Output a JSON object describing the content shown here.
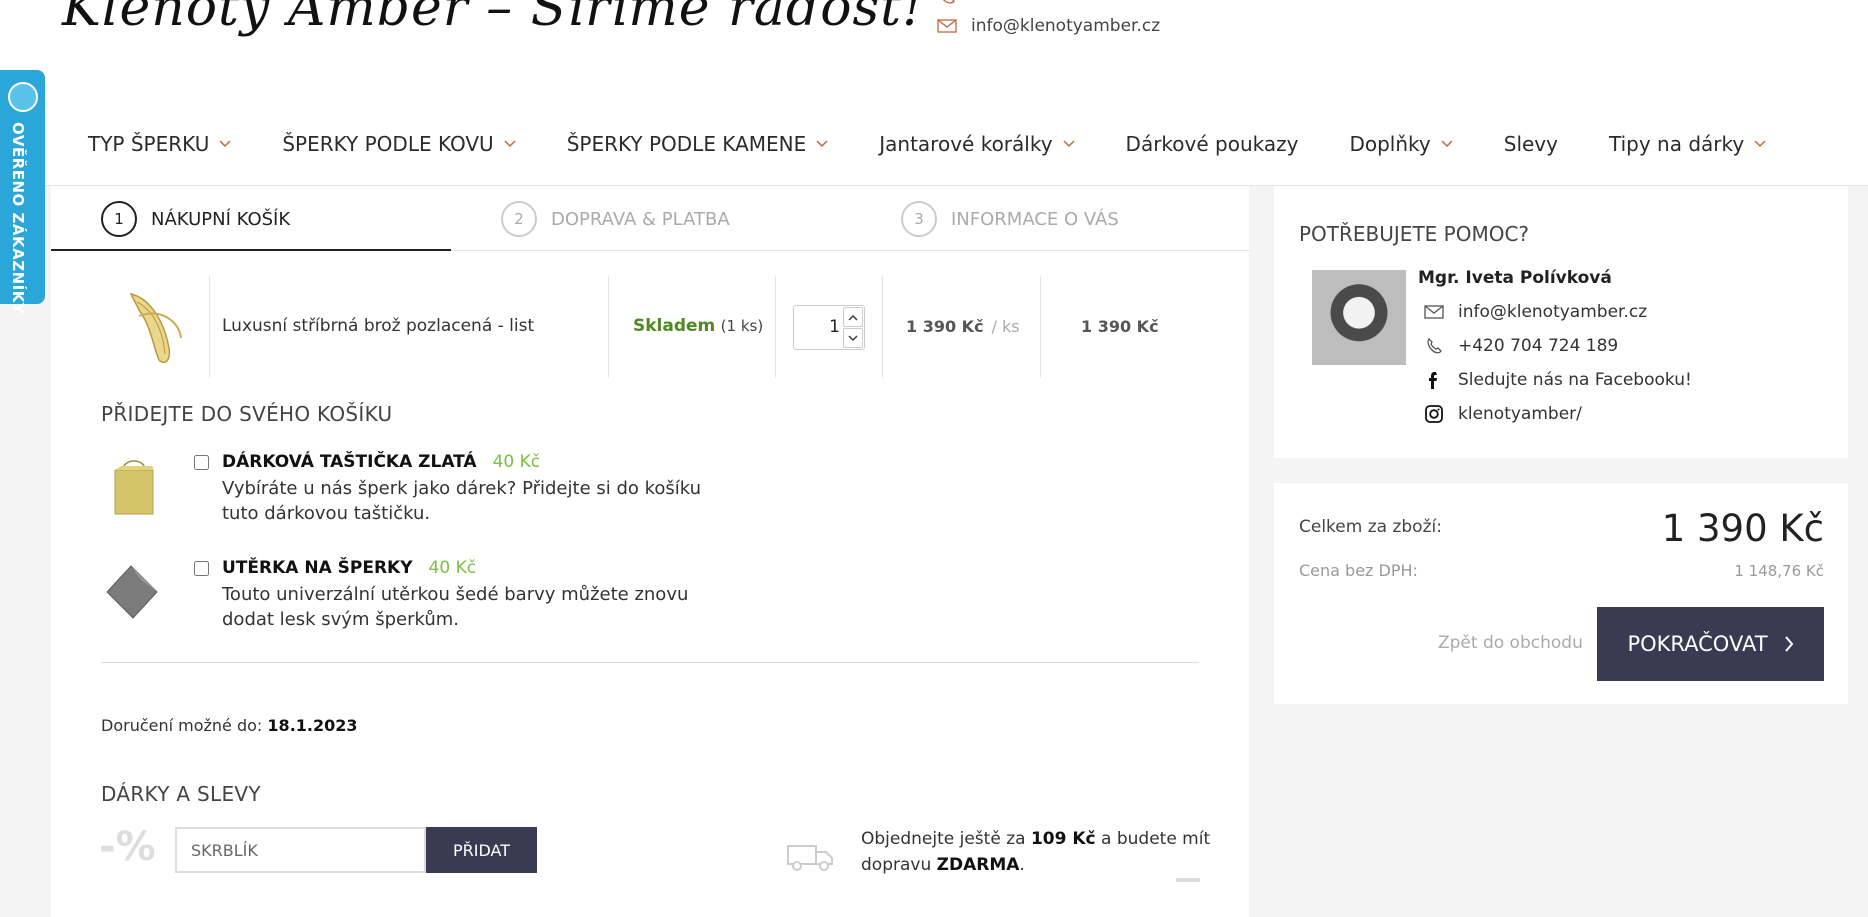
{
  "header": {
    "logo_text": "Klenoty Amber – Šíříme radost!",
    "email": "info@klenotyamber.cz",
    "phone_partial": ""
  },
  "nav": [
    {
      "label": "TYP ŠPERKU",
      "dropdown": true
    },
    {
      "label": "ŠPERKY PODLE KOVU",
      "dropdown": true
    },
    {
      "label": "ŠPERKY PODLE KAMENE",
      "dropdown": true
    },
    {
      "label": "Jantarové korálky",
      "dropdown": true
    },
    {
      "label": "Dárkové poukazy",
      "dropdown": false
    },
    {
      "label": "Doplňky",
      "dropdown": true
    },
    {
      "label": "Slevy",
      "dropdown": false
    },
    {
      "label": "Tipy na dárky",
      "dropdown": true
    }
  ],
  "badge": {
    "text": "OVĚŘENO ZÁKAZNÍKY"
  },
  "steps": [
    {
      "num": "1",
      "label": "NÁKUPNÍ KOŠÍK"
    },
    {
      "num": "2",
      "label": "DOPRAVA & PLATBA"
    },
    {
      "num": "3",
      "label": "INFORMACE O VÁS"
    }
  ],
  "cart": {
    "item": {
      "name": "Luxusní stříbrná brož pozlacená - list",
      "stock_label": "Skladem",
      "stock_qty": "(1 ks)",
      "quantity": "1",
      "unit_price": "1 390 Kč",
      "unit_suffix": "/ ks",
      "total_price": "1 390 Kč"
    }
  },
  "addons": {
    "title": "PŘIDEJTE DO SVÉHO KOŠÍKU",
    "items": [
      {
        "title": "DÁRKOVÁ TAŠTIČKA ZLATÁ",
        "price": "40 Kč",
        "desc": "Vybíráte u nás šperk jako dárek? Přidejte si do košíku tuto dárkovou taštičku."
      },
      {
        "title": "UTĚRKA NA ŠPERKY",
        "price": "40 Kč",
        "desc": "Touto univerzální utěrkou šedé barvy můžete znovu dodat lesk svým šperkům."
      }
    ]
  },
  "delivery": {
    "label": "Doručení možné do:",
    "date": "18.1.2023"
  },
  "gifts": {
    "title": "DÁRKY A SLEVY",
    "percent_icon": "-%",
    "coupon_value": "SKRBLÍK",
    "add_label": "PŘIDAT",
    "free_ship_pre": "Objednejte ještě za",
    "free_ship_amount": "109 Kč",
    "free_ship_mid": "a budete mít",
    "free_ship_pre2": "dopravu",
    "free_ship_word": "ZDARMA",
    "free_ship_end": "."
  },
  "help": {
    "title": "POTŘEBUJETE POMOC?",
    "name": "Mgr. Iveta Polívková",
    "email": "info@klenotyamber.cz",
    "phone": "+420 704 724 189",
    "facebook": "Sledujte nás na Facebooku!",
    "instagram": "klenotyamber/"
  },
  "summary": {
    "total_label": "Celkem za zboží:",
    "total_value": "1 390 Kč",
    "net_label": "Cena bez DPH:",
    "net_value": "1 148,76 Kč",
    "back_label": "Zpět do obchodu",
    "continue_label": "POKRAČOVAT"
  },
  "colors": {
    "accent_dark": "#3a3a52",
    "stock_green": "#4e8a1f",
    "price_green": "#7bbf45",
    "badge_blue": "#2aa6d8",
    "chevron": "#c0673c"
  }
}
